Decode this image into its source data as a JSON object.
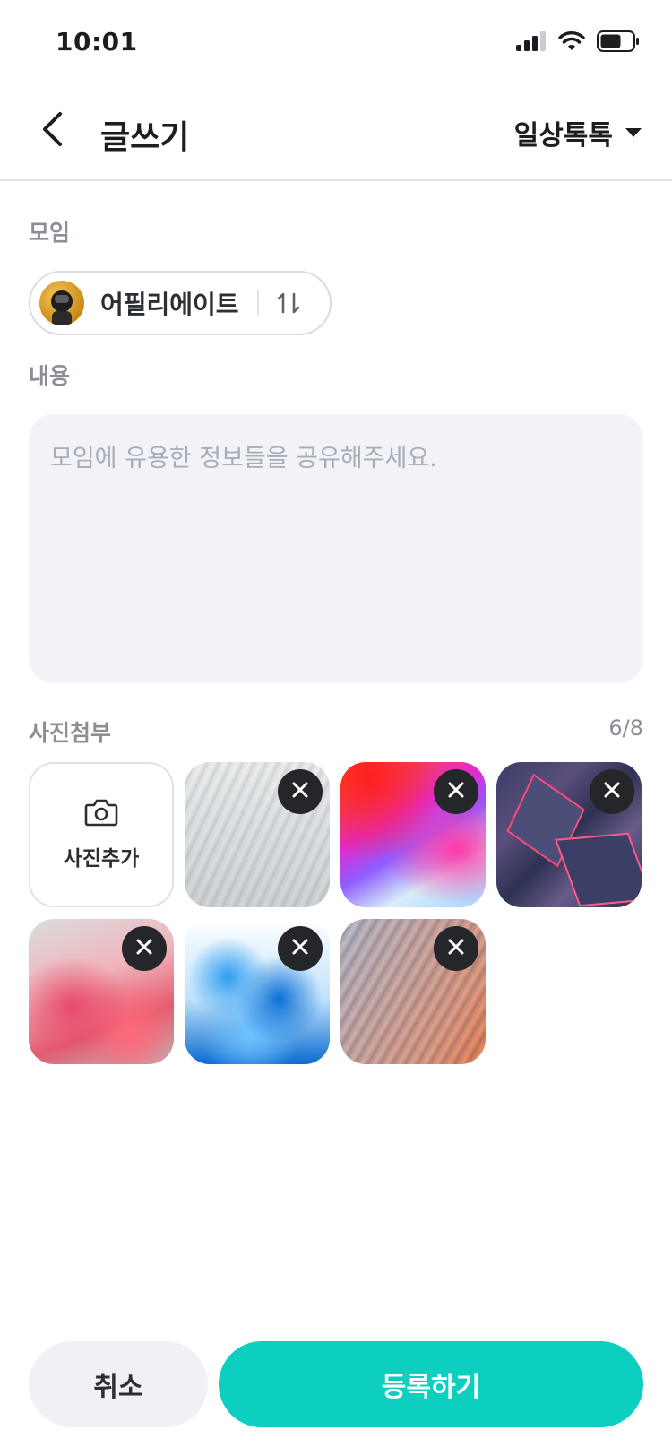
{
  "status_bar": {
    "time": "10:01",
    "icons": [
      "signal-icon",
      "wifi-icon",
      "battery-icon"
    ]
  },
  "header": {
    "title": "글쓰기",
    "board_select": "일상톡톡",
    "icons": [
      "back-arrow-icon",
      "caret-down-icon"
    ]
  },
  "group": {
    "label": "모임",
    "name": "어필리에이트",
    "icons": [
      "swap-icon"
    ]
  },
  "content": {
    "label": "내용",
    "value": "",
    "placeholder": "모임에 유용한 정보들을 공유해주세요."
  },
  "photos": {
    "label": "사진첨부",
    "count": "6/8",
    "add_label": "사진추가",
    "add_icon": "camera-icon",
    "remove_icon": "close-icon",
    "items": [
      "white-waves",
      "colorful-gradient",
      "dark-polygons",
      "pink-marble",
      "blue-ink",
      "gray-orange-waves"
    ]
  },
  "footer": {
    "cancel_label": "취소",
    "submit_label": "등록하기"
  },
  "colors": {
    "accent": "#0ccfbf",
    "input_bg": "#f1f3f8",
    "label_gray": "#8a8e96"
  }
}
